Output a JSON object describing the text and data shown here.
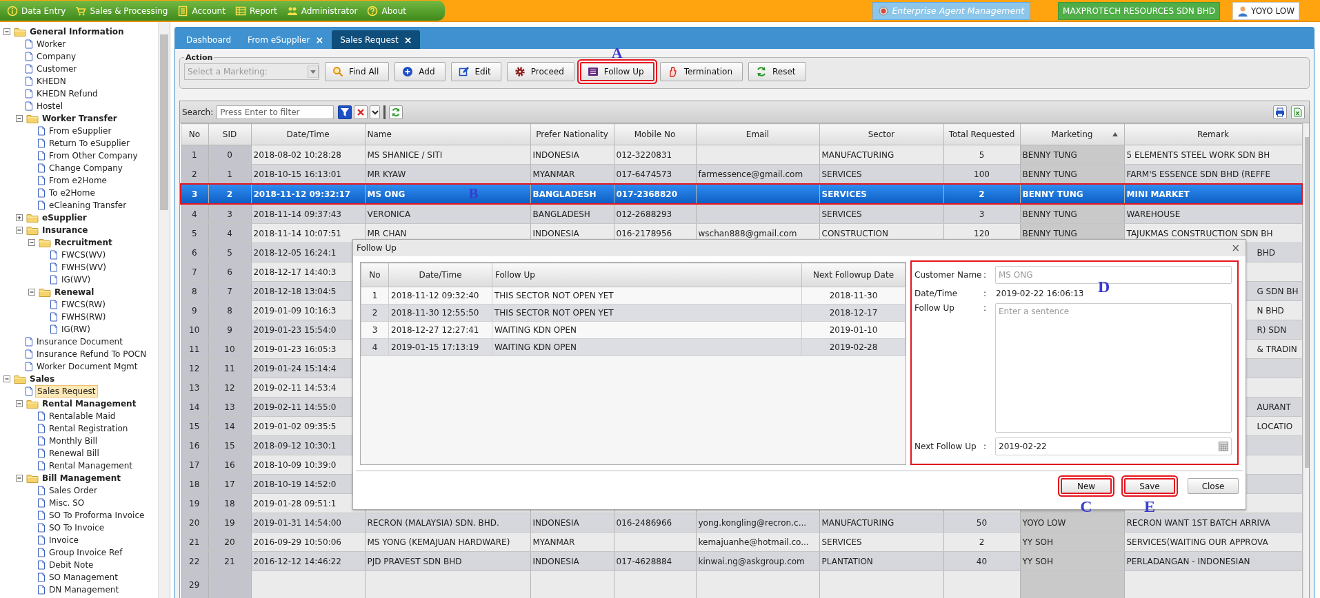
{
  "menubar": {
    "items": [
      {
        "label": "Data Entry"
      },
      {
        "label": "Sales & Processing"
      },
      {
        "label": "Account"
      },
      {
        "label": "Report"
      },
      {
        "label": "Administrator"
      },
      {
        "label": "About"
      }
    ]
  },
  "header": {
    "app": "Enterprise Agent Management",
    "company": "MAXPROTECH RESOURCES SDN BHD",
    "user": "YOYO LOW"
  },
  "sidebar": {
    "tree": [
      {
        "kind": "folder",
        "label": "General Information",
        "expanded": true,
        "children": [
          {
            "kind": "page",
            "label": "Worker",
            "selected": false
          },
          {
            "kind": "page",
            "label": "Company",
            "selected": false
          },
          {
            "kind": "page",
            "label": "Customer",
            "selected": false
          },
          {
            "kind": "page",
            "label": "KHEDN",
            "selected": false
          },
          {
            "kind": "page",
            "label": "KHEDN Refund",
            "selected": false
          },
          {
            "kind": "page",
            "label": "Hostel",
            "selected": false
          },
          {
            "kind": "folder",
            "label": "Worker Transfer",
            "expanded": true,
            "children": [
              {
                "kind": "page",
                "label": "From eSupplier",
                "selected": false
              },
              {
                "kind": "page",
                "label": "Return To eSupplier",
                "selected": false
              },
              {
                "kind": "page",
                "label": "From Other Company",
                "selected": false
              },
              {
                "kind": "page",
                "label": "Change Company",
                "selected": false
              },
              {
                "kind": "page",
                "label": "From e2Home",
                "selected": false
              },
              {
                "kind": "page",
                "label": "To e2Home",
                "selected": false
              },
              {
                "kind": "page",
                "label": "eCleaning Transfer",
                "selected": false
              }
            ]
          },
          {
            "kind": "folder",
            "label": "eSupplier",
            "expanded": false
          },
          {
            "kind": "folder",
            "label": "Insurance",
            "expanded": true,
            "children": [
              {
                "kind": "folder",
                "label": "Recruitment",
                "expanded": true,
                "children": [
                  {
                    "kind": "page",
                    "label": "FWCS(WV)",
                    "selected": false
                  },
                  {
                    "kind": "page",
                    "label": "FWHS(WV)",
                    "selected": false
                  },
                  {
                    "kind": "page",
                    "label": "IG(WV)",
                    "selected": false
                  }
                ]
              },
              {
                "kind": "folder",
                "label": "Renewal",
                "expanded": true,
                "children": [
                  {
                    "kind": "page",
                    "label": "FWCS(RW)",
                    "selected": false
                  },
                  {
                    "kind": "page",
                    "label": "FWHS(RW)",
                    "selected": false
                  },
                  {
                    "kind": "page",
                    "label": "IG(RW)",
                    "selected": false
                  }
                ]
              }
            ]
          },
          {
            "kind": "page",
            "label": "Insurance Document",
            "selected": false
          },
          {
            "kind": "page",
            "label": "Insurance Refund To POCN",
            "selected": false
          },
          {
            "kind": "page",
            "label": "Worker Document Mgmt",
            "selected": false
          }
        ]
      },
      {
        "kind": "folder",
        "label": "Sales",
        "expanded": true,
        "children": [
          {
            "kind": "page",
            "label": "Sales Request",
            "selected": true
          },
          {
            "kind": "folder",
            "label": "Rental Management",
            "expanded": true,
            "children": [
              {
                "kind": "page",
                "label": "Rentalable Maid",
                "selected": false
              },
              {
                "kind": "page",
                "label": "Rental Registration",
                "selected": false
              },
              {
                "kind": "page",
                "label": "Monthly Bill",
                "selected": false
              },
              {
                "kind": "page",
                "label": "Renewal Bill",
                "selected": false
              },
              {
                "kind": "page",
                "label": "Rental Management",
                "selected": false
              }
            ]
          },
          {
            "kind": "folder",
            "label": "Bill Management",
            "expanded": true,
            "children": [
              {
                "kind": "page",
                "label": "Sales Order",
                "selected": false
              },
              {
                "kind": "page",
                "label": "Misc. SO",
                "selected": false
              },
              {
                "kind": "page",
                "label": "SO To Proforma Invoice",
                "selected": false
              },
              {
                "kind": "page",
                "label": "SO To Invoice",
                "selected": false
              },
              {
                "kind": "page",
                "label": "Invoice",
                "selected": false
              },
              {
                "kind": "page",
                "label": "Group Invoice Ref",
                "selected": false
              },
              {
                "kind": "page",
                "label": "Debit Note",
                "selected": false
              },
              {
                "kind": "page",
                "label": "SO Management",
                "selected": false
              },
              {
                "kind": "page",
                "label": "DN Management",
                "selected": false
              }
            ]
          }
        ]
      }
    ]
  },
  "tabs": [
    {
      "label": "Dashboard",
      "selected": false
    },
    {
      "label": "From eSupplier",
      "close": "×",
      "selected": false
    },
    {
      "label": "Sales Request",
      "close": "×",
      "selected": true
    }
  ],
  "action": {
    "legend": "Action",
    "marketing_select": {
      "placeholder": "Select a Marketing:"
    },
    "buttons": [
      {
        "label": "Find All",
        "highlighted": false
      },
      {
        "label": "Add",
        "highlighted": false
      },
      {
        "label": "Edit",
        "highlighted": false
      },
      {
        "label": "Proceed",
        "highlighted": false
      },
      {
        "label": "Follow Up",
        "highlighted": true,
        "callout": "A"
      },
      {
        "label": "Termination",
        "highlighted": false
      },
      {
        "label": "Reset",
        "highlighted": false
      }
    ]
  },
  "grid": {
    "search_label": "Search:",
    "search": {
      "placeholder": "Press Enter to filter"
    },
    "columns": [
      {
        "label": "No",
        "sorted": false
      },
      {
        "label": "SID",
        "sorted": false
      },
      {
        "label": "Date/Time",
        "sorted": false
      },
      {
        "label": "Name",
        "sorted": false
      },
      {
        "label": "Prefer Nationality",
        "sorted": false
      },
      {
        "label": "Mobile No",
        "sorted": false
      },
      {
        "label": "Email",
        "sorted": false
      },
      {
        "label": "Sector",
        "sorted": false
      },
      {
        "label": "Total Requested",
        "sorted": false
      },
      {
        "label": "Marketing",
        "sorted": true
      },
      {
        "label": "Remark",
        "sorted": false
      }
    ],
    "rows": [
      {
        "kind": "full",
        "selected": false,
        "highlighted": false,
        "no": "1",
        "sid": "0",
        "datetime": "2018-08-02 10:28:28",
        "name": "MS SHANICE / SITI",
        "nationality": "INDONESIA",
        "mobile": "012-3220831",
        "sector": "MANUFACTURING",
        "total_requested": "5",
        "marketing": "BENNY TUNG",
        "remark": "5 ELEMENTS STEEL WORK SDN BH"
      },
      {
        "kind": "full",
        "selected": false,
        "highlighted": false,
        "no": "2",
        "sid": "1",
        "datetime": "2018-10-15 16:13:01",
        "name": "MR KYAW",
        "nationality": "MYANMAR",
        "mobile": "017-6474573",
        "email": "farmessence@gmail.com",
        "sector": "SERVICES",
        "total_requested": "100",
        "marketing": "BENNY TUNG",
        "remark": "FARM'S ESSENCE SDN BHD (REFFE"
      },
      {
        "kind": "full",
        "selected": true,
        "highlighted": true,
        "callout": "B",
        "no": "3",
        "sid": "2",
        "datetime": "2018-11-12 09:32:17",
        "name": "MS ONG",
        "nationality": "BANGLADESH",
        "mobile": "017-2368820",
        "sector": "SERVICES",
        "total_requested": "2",
        "marketing": "BENNY TUNG",
        "remark": "MINI MARKET"
      },
      {
        "kind": "full",
        "selected": false,
        "highlighted": false,
        "no": "4",
        "sid": "3",
        "datetime": "2018-11-14 09:37:43",
        "name": "VERONICA",
        "nationality": "BANGLADESH",
        "mobile": "012-2688293",
        "sector": "SERVICES",
        "total_requested": "3",
        "marketing": "BENNY TUNG",
        "remark": "WAREHOUSE"
      },
      {
        "kind": "full",
        "selected": false,
        "highlighted": false,
        "no": "5",
        "sid": "4",
        "datetime": "2018-11-14 10:07:51",
        "name": "MR CHAN",
        "nationality": "INDONESIA",
        "mobile": "016-2178956",
        "email": "wschan888@gmail.com",
        "sector": "CONSTRUCTION",
        "total_requested": "120",
        "marketing": "BENNY TUNG",
        "remark": "TAJUKMAS CONSTRUCTION SDN BH"
      },
      {
        "kind": "partial",
        "selected": false,
        "highlighted": false,
        "no": "6",
        "sid": "5",
        "datetime": "2018-12-05 16:24:1",
        "remark_visible": "BHD"
      },
      {
        "kind": "partial",
        "selected": false,
        "highlighted": false,
        "no": "7",
        "sid": "6",
        "datetime": "2018-12-17 14:40:3"
      },
      {
        "kind": "partial",
        "selected": false,
        "highlighted": false,
        "no": "8",
        "sid": "7",
        "datetime": "2018-12-18 13:04:5",
        "remark_visible": "G SDN BH"
      },
      {
        "kind": "partial",
        "selected": false,
        "highlighted": false,
        "no": "9",
        "sid": "8",
        "datetime": "2019-01-09 10:16:3",
        "remark_visible": "N BHD"
      },
      {
        "kind": "partial",
        "selected": false,
        "highlighted": false,
        "no": "10",
        "sid": "9",
        "datetime": "2019-01-23 15:54:0",
        "remark_visible": "R) SDN"
      },
      {
        "kind": "partial",
        "selected": false,
        "highlighted": false,
        "no": "11",
        "sid": "10",
        "datetime": "2019-01-23 16:05:3",
        "remark_visible": "& TRADIN"
      },
      {
        "kind": "partial",
        "selected": false,
        "highlighted": false,
        "no": "12",
        "sid": "11",
        "datetime": "2019-01-24 15:14:4"
      },
      {
        "kind": "partial",
        "selected": false,
        "highlighted": false,
        "no": "13",
        "sid": "12",
        "datetime": "2019-02-11 14:53:4"
      },
      {
        "kind": "partial",
        "selected": false,
        "highlighted": false,
        "no": "14",
        "sid": "13",
        "datetime": "2019-02-11 14:55:0",
        "remark_visible": "AURANT"
      },
      {
        "kind": "partial",
        "selected": false,
        "highlighted": false,
        "no": "15",
        "sid": "14",
        "datetime": "2019-01-02 09:35:5",
        "remark_visible": "LOCATIO"
      },
      {
        "kind": "partial",
        "selected": false,
        "highlighted": false,
        "no": "16",
        "sid": "15",
        "datetime": "2018-09-12 10:30:1"
      },
      {
        "kind": "partial",
        "selected": false,
        "highlighted": false,
        "no": "17",
        "sid": "16",
        "datetime": "2018-10-09 10:39:0"
      },
      {
        "kind": "partial",
        "selected": false,
        "highlighted": false,
        "no": "18",
        "sid": "17",
        "datetime": "2018-10-19 14:52:0"
      },
      {
        "kind": "partial",
        "selected": false,
        "highlighted": false,
        "no": "19",
        "sid": "18",
        "datetime": "2019-01-28 09:51:1"
      },
      {
        "kind": "full",
        "selected": false,
        "highlighted": false,
        "no": "20",
        "sid": "19",
        "datetime": "2019-01-31 14:54:00",
        "name": "RECRON (MALAYSIA) SDN. BHD.",
        "nationality": "INDONESIA",
        "mobile": "016-2486966",
        "email": "yong.kongling@recron.c...",
        "sector": "MANUFACTURING",
        "total_requested": "50",
        "marketing": "YOYO LOW",
        "remark": "RECRON WANT 1ST BATCH ARRIVA"
      },
      {
        "kind": "full",
        "selected": false,
        "highlighted": false,
        "no": "21",
        "sid": "20",
        "datetime": "2016-09-29 10:50:06",
        "name": "MS YONG (KEMAJUAN HARDWARE)",
        "nationality": "MYANMAR",
        "email": "kemajuanhe@hotmail.co...",
        "sector": "SERVICES",
        "total_requested": "2",
        "marketing": "YY SOH",
        "remark": "SERVICES(WAITING OUR APPROVA"
      },
      {
        "kind": "full",
        "selected": false,
        "highlighted": false,
        "no": "22",
        "sid": "21",
        "datetime": "2016-12-12 14:46:22",
        "name": "PJD PRAVEST SDN BHD",
        "nationality": "INDONESIA",
        "mobile": "017-4628884",
        "email": "kinwai.ng@askgroup.com",
        "sector": "PLANTATION",
        "total_requested": "40",
        "marketing": "YY SOH",
        "remark": "PERLADANGAN - INDONESIAN"
      },
      {
        "kind": "empty",
        "selected": false,
        "highlighted": false,
        "no": "29"
      }
    ]
  },
  "dialog": {
    "title": "Follow Up",
    "close": "×",
    "columns": [
      {
        "label": "No"
      },
      {
        "label": "Date/Time"
      },
      {
        "label": "Follow Up"
      },
      {
        "label": "Next Followup Date"
      }
    ],
    "rows": [
      {
        "no": "1",
        "datetime": "2018-11-12 09:32:40",
        "follow_up": "THIS SECTOR NOT OPEN YET",
        "next_date": "2018-11-30"
      },
      {
        "no": "2",
        "datetime": "2018-11-30 12:55:50",
        "follow_up": "THIS SECTOR NOT OPEN YET",
        "next_date": "2018-12-17"
      },
      {
        "no": "3",
        "datetime": "2018-12-27 12:27:41",
        "follow_up": "WAITING KDN OPEN",
        "next_date": "2019-01-10"
      },
      {
        "no": "4",
        "datetime": "2019-01-15 17:13:19",
        "follow_up": "WAITING KDN OPEN",
        "next_date": "2019-02-28"
      }
    ],
    "form": {
      "highlighted": true,
      "callout": "D",
      "fields": [
        {
          "kind": "input",
          "label": "Customer Name",
          "separator": ":",
          "value": "MS ONG",
          "disabled": true
        },
        {
          "kind": "text",
          "label": "Date/Time",
          "separator": ":",
          "value": "2019-02-22 16:06:13"
        },
        {
          "kind": "textarea",
          "label": "Follow Up",
          "separator": ":",
          "placeholder": "Enter a sentence",
          "disabled": false
        },
        {
          "kind": "date",
          "label": "Next Follow Up",
          "separator": ":",
          "value": "2019-02-22",
          "disabled": false
        }
      ]
    },
    "buttons": [
      {
        "label": "New",
        "highlighted": true,
        "callout": "C"
      },
      {
        "label": "Save",
        "highlighted": true,
        "callout": "E"
      },
      {
        "label": "Close",
        "highlighted": false
      }
    ]
  }
}
